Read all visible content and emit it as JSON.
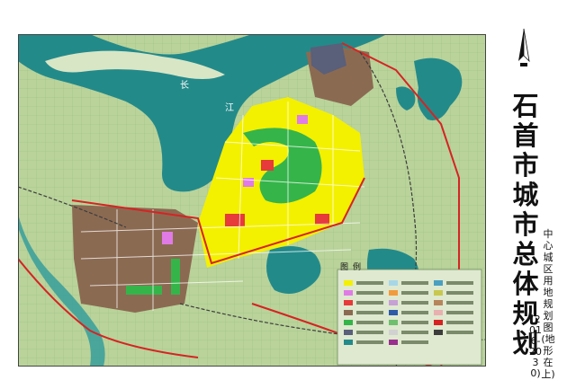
{
  "title": {
    "main": "石首市城市总体规划",
    "sub": "中心城区用地规划图(地形在上)",
    "years": "(2016-2030)"
  },
  "map": {
    "labels": [
      {
        "id": "chang",
        "text": "长"
      },
      {
        "id": "jiang",
        "text": "江"
      },
      {
        "id": "tu",
        "text": "图"
      },
      {
        "id": "li",
        "text": "例"
      }
    ]
  },
  "colors": {
    "background": "#b9d39a",
    "river": "#238a8a",
    "residential": "#f3f000",
    "industrial": "#8b6a52",
    "commercial": "#e73a3a",
    "green": "#35b44a",
    "public": "#e07be6",
    "road": "#d62323"
  }
}
